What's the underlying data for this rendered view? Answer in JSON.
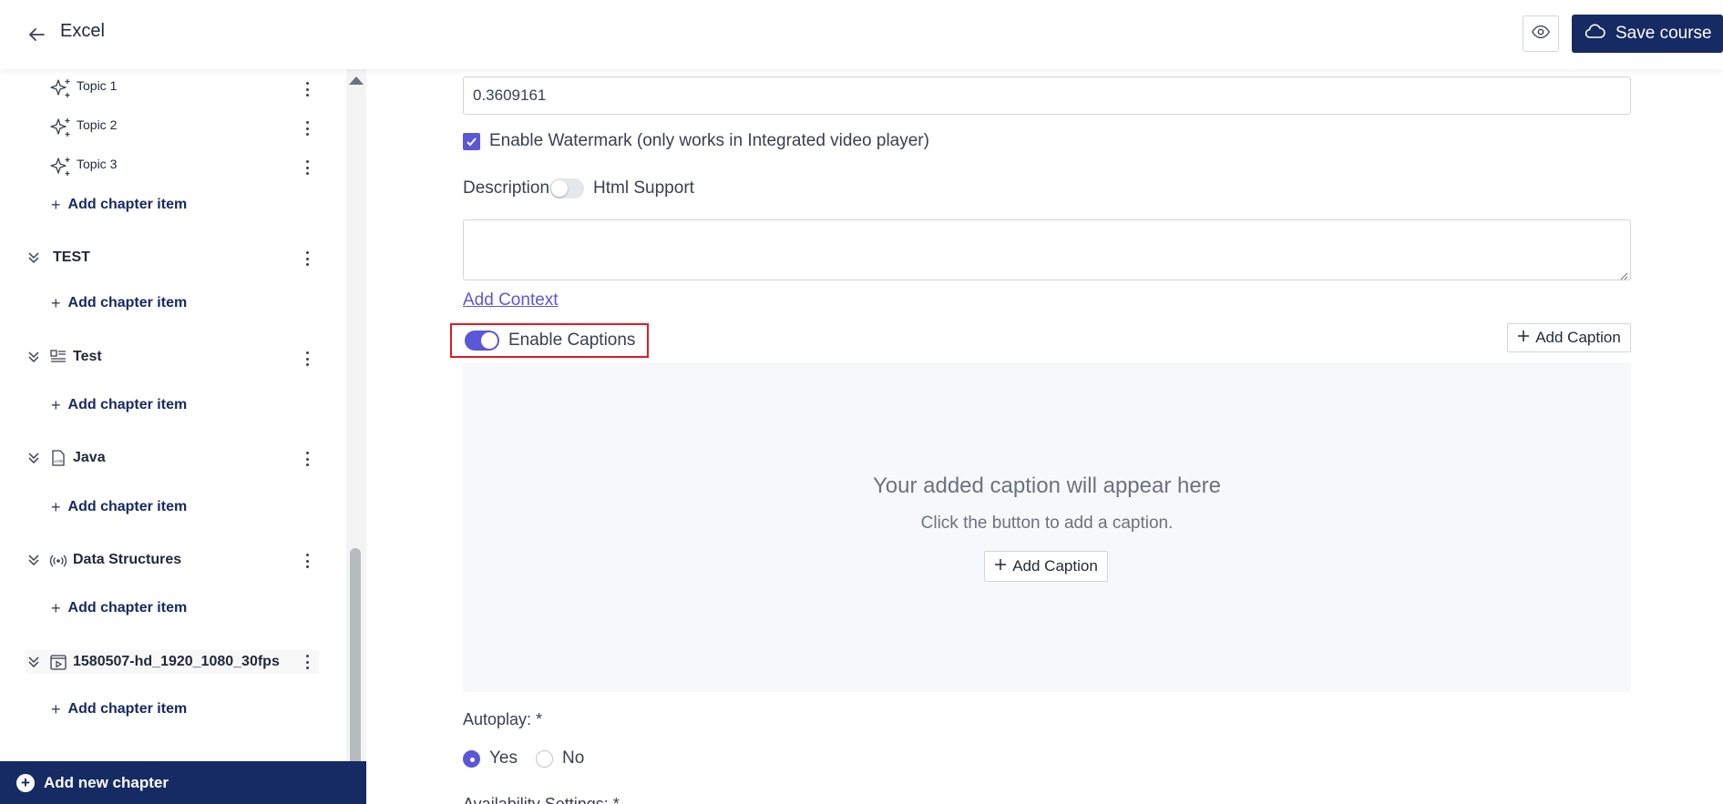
{
  "header": {
    "course_title": "Excel",
    "save_label": "Save course"
  },
  "sidebar": {
    "topics": [
      {
        "label": "Topic 1"
      },
      {
        "label": "Topic 2"
      },
      {
        "label": "Topic 3"
      }
    ],
    "add_item_label": "Add chapter item",
    "chapters": [
      {
        "label": "TEST",
        "icon": "none"
      },
      {
        "label": "Test",
        "icon": "quiz-icon"
      },
      {
        "label": "Java",
        "icon": "live-file-icon"
      },
      {
        "label": "Data Structures",
        "icon": "broadcast-icon"
      },
      {
        "label": "1580507-hd_1920_1080_30fps",
        "icon": "video-icon"
      }
    ],
    "add_chapter_label": "Add new chapter"
  },
  "main": {
    "input_value": "0.3609161",
    "watermark_label": "Enable Watermark (only works in Integrated video player)",
    "watermark_checked": true,
    "description_label": "Description",
    "html_support_label": "Html Support",
    "add_context_label": "Add Context",
    "captions_label": "Enable Captions",
    "captions_enabled": true,
    "add_caption_label": "Add Caption",
    "caption_empty_title": "Your added caption will appear here",
    "caption_empty_sub": "Click the button to add a caption.",
    "autoplay_label": "Autoplay: *",
    "autoplay_yes": "Yes",
    "autoplay_no": "No",
    "availability_label": "Availability Settings: *"
  },
  "colors": {
    "brand": "#162a63",
    "accent": "#5b57d6",
    "highlight": "#e01b24"
  }
}
